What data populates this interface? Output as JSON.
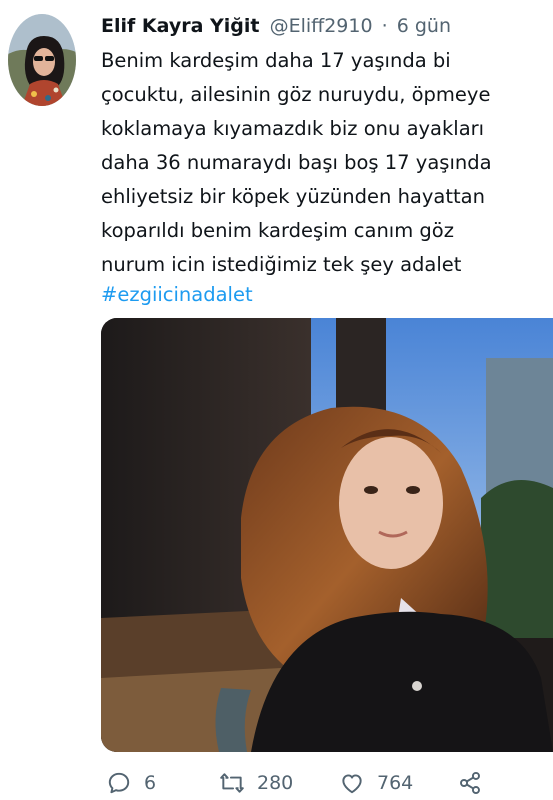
{
  "tweet": {
    "author": {
      "display_name": "Elif Kayra Yiğit",
      "handle": "@Eliff2910"
    },
    "separator": "·",
    "time_ago": "6 gün",
    "text_lines": [
      "Benim kardeşim daha 17 yaşında bi",
      "çocuktu, ailesinin göz nuruydu, öpmeye",
      "koklamaya kıyamazdık biz onu ayakları",
      "daha 36 numaraydı başı boş 17 yaşında",
      "ehliyetsiz bir köpek yüzünden hayattan",
      "koparıldı benim kardeşim canım göz",
      "nurum icin istediğimiz tek şey adalet"
    ],
    "hashtag": "#ezgiicinadalet",
    "media_icon": "photo",
    "actions": {
      "reply_count": "6",
      "retweet_count": "280",
      "like_count": "764",
      "reply_icon": "reply-icon",
      "retweet_icon": "retweet-icon",
      "like_icon": "heart-icon",
      "share_icon": "share-icon"
    },
    "colors": {
      "text": "#0f1419",
      "secondary": "#536471",
      "link": "#1d9bf0"
    }
  }
}
